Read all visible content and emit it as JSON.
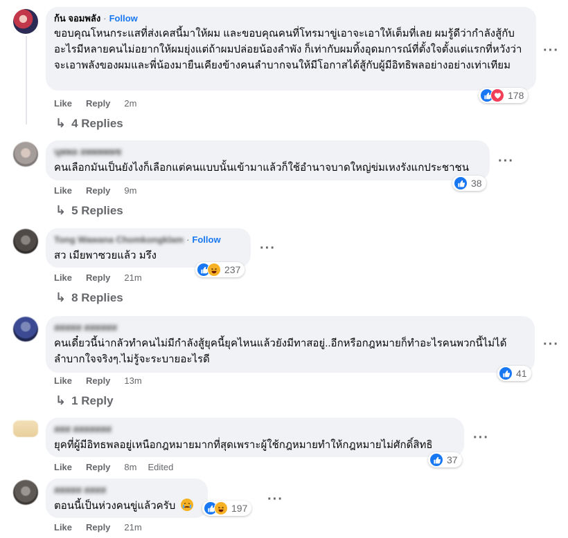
{
  "comments": [
    {
      "author": "ก้น จอมพลัง",
      "follow": "Follow",
      "text": "ขอบคุณโหนกระแสที่ส่งเคสนี้มาให้ผม และขอบคุณคนที่โทรมาขู่เอาจะเอาให้เต็มที่เลย ผมรู้ดีว่ากำลังสู้กับอะไรมีหลายคนไม่อยากให้ผมยุ่งแต่ถ้าผมปล่อยน้องลำพัง ก็เท่ากับผมทิ้งอุดมการณ์ที่ตั้งใจตั้งแต่แรกที่หวังว่า จะเอาพลังของผมและพี่น้องมายืนเคียงข้างคนลำบากจนให้มีโอกาสได้สู้กับผู้มีอิทธิพลอย่างอย่างเท่าเทียม",
      "like": "Like",
      "reply": "Reply",
      "time": "2m",
      "reactions": "178",
      "replies": "4 Replies"
    },
    {
      "author": "นุพพล ลพพพพพช",
      "text": "คนเลือกมันเป็นยังไงก็เลือกแต่คนแบบนั้นเข้ามาแล้วก็ใช้อำนาจบาดใหญ่ข่มเหงรังแกประชาชน",
      "like": "Like",
      "reply": "Reply",
      "time": "9m",
      "reactions": "38",
      "replies": "5 Replies"
    },
    {
      "author": "Tong Wawana Chomkongklam",
      "follow": "Follow",
      "text": "สว เมียพาซวยแล้ว มรึง",
      "like": "Like",
      "reply": "Reply",
      "time": "21m",
      "reactions": "237",
      "replies": "8 Replies"
    },
    {
      "author": "สสสสส สสสสสส",
      "text": "คนเดี๋ยวนี้น่ากลัวทำคนไม่มีกำลังสู้ยุคนี้ยุคไหนแล้วยังมีทาสอยู่..อีกหรือกฎหมายก็ทำอะไรคนพวกนี้ไม่ได้ ลำบากใจจริงๆ.ไม่รู้จะระบายอะไรดี",
      "like": "Like",
      "reply": "Reply",
      "time": "13m",
      "reactions": "41",
      "replies": "1 Reply"
    },
    {
      "author": "สสส สสสสสสส",
      "text": "ยุคที่ผู้มีอิทธพลอยู่เหนือกฎหมายมากที่สุดเพราะผู้ใช้กฎหมายทำให้กฎหมายไม่ศักดิ์สิทธิ",
      "like": "Like",
      "reply": "Reply",
      "time": "8m",
      "edited": "Edited",
      "reactions": "37"
    },
    {
      "author": "สสสสส สสสส",
      "text": "ตอนนี้เป็นห่วงคนขู่แล้วครับ",
      "like": "Like",
      "reply": "Reply",
      "time": "21m",
      "reactions": "197"
    }
  ],
  "icons": {
    "like": "like-icon",
    "love": "love-icon",
    "haha": "haha-icon",
    "more": "more-icon",
    "reply_arrow": "reply-arrow-icon"
  },
  "colors": {
    "bubble": "#f0f2f5",
    "follow": "#1877f2",
    "meta": "#65676b",
    "like": "#1877f2",
    "love": "#f33e58",
    "haha": "#f7b125"
  }
}
